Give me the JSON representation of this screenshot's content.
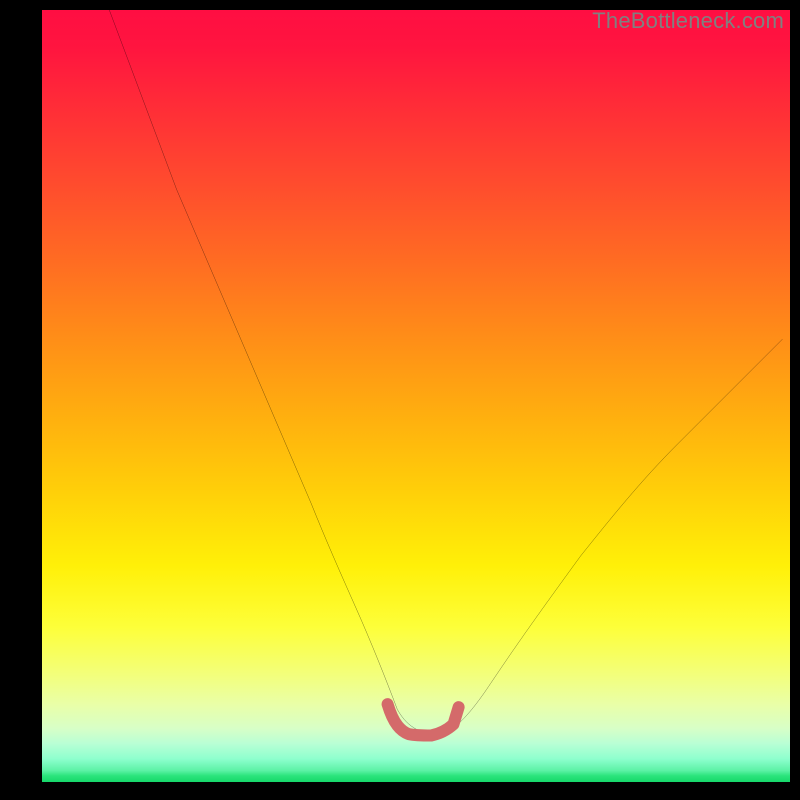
{
  "attribution": "TheBottleneck.com",
  "chart_data": {
    "type": "line",
    "title": "",
    "xlabel": "",
    "ylabel": "",
    "xlim": [
      0,
      100
    ],
    "ylim": [
      0,
      100
    ],
    "grid": false,
    "legend": false,
    "background": "rainbow-gradient-red-to-green-vertical",
    "series": [
      {
        "name": "bottleneck-curve",
        "color": "#000000",
        "x": [
          9.0,
          12,
          15,
          18,
          21,
          24,
          27,
          30,
          33,
          36,
          38,
          40,
          42,
          44,
          46,
          47.5,
          49,
          51,
          53,
          55,
          57,
          60,
          64,
          68,
          72,
          76,
          80,
          85,
          90,
          95,
          99
        ],
        "y": [
          100,
          92,
          84,
          76,
          69,
          62,
          55,
          48,
          41,
          34,
          29,
          24.5,
          20,
          15.5,
          10.5,
          6.5,
          3.8,
          3.2,
          3.2,
          3.5,
          5.5,
          10,
          16,
          21.5,
          27,
          32,
          37,
          42,
          47,
          52,
          56
        ]
      },
      {
        "name": "optimal-band-marker",
        "color": "#d46a6a",
        "stroke_width": 12,
        "x": [
          46.2,
          47.0,
          48.0,
          49.0,
          50.0,
          51.0,
          52.0,
          53.0,
          54.0,
          55.0,
          55.7
        ],
        "y": [
          7.2,
          4.5,
          3.6,
          3.2,
          3.0,
          3.0,
          3.0,
          3.2,
          3.6,
          4.5,
          6.8
        ]
      }
    ]
  }
}
